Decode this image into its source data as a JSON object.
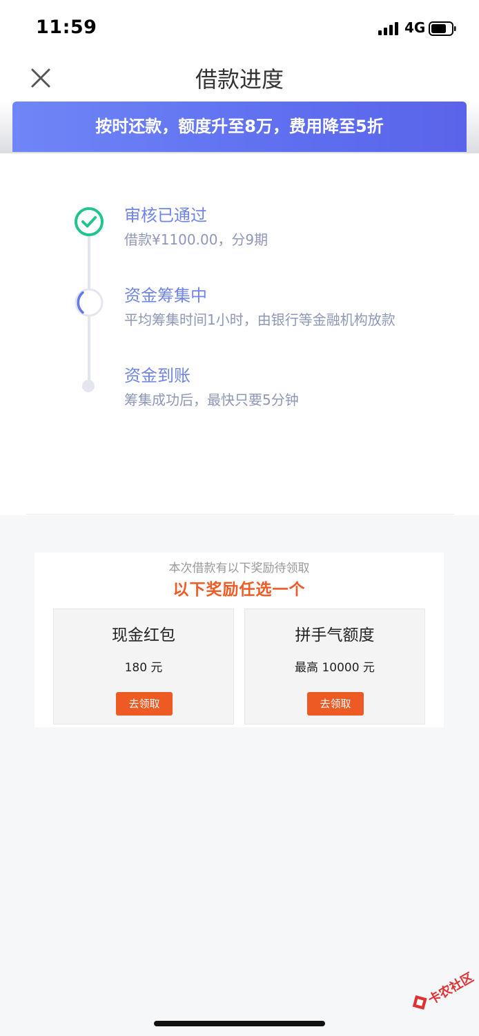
{
  "status_bar": {
    "time": "11:59",
    "network": "4G",
    "icons": [
      "signal-icon",
      "battery-icon"
    ]
  },
  "nav": {
    "title": "借款进度",
    "close_icon": "close-icon"
  },
  "banner": {
    "text": "按时还款，额度升至8万，费用降至5折"
  },
  "progress": {
    "steps": [
      {
        "title": "审核已通过",
        "desc": "借款¥1100.00，分9期",
        "state": "done"
      },
      {
        "title": "资金筹集中",
        "desc": "平均筹集时间1小时，由银行等金融机构放款",
        "state": "current"
      },
      {
        "title": "资金到账",
        "desc": "筹集成功后，最快只要5分钟",
        "state": "pending"
      }
    ]
  },
  "rewards": {
    "subtitle": "本次借款有以下奖励待领取",
    "title": "以下奖励任选一个",
    "cards": [
      {
        "title": "现金红包",
        "value": "180 元",
        "button": "去领取"
      },
      {
        "title": "拼手气额度",
        "value": "最高 10000 元",
        "button": "去领取"
      }
    ]
  },
  "watermark": {
    "text": "卡农社区"
  },
  "colors": {
    "accent_blue": "#6f84e8",
    "success_green": "#1fc48f",
    "reward_orange": "#ee5a23"
  }
}
